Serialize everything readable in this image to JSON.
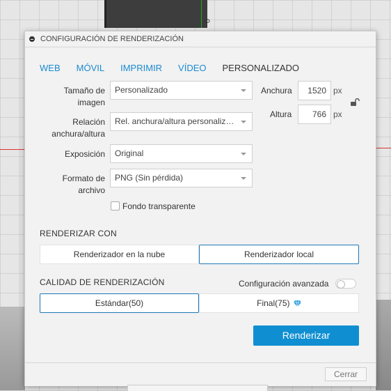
{
  "dialog": {
    "title": "CONFIGURACIÓN DE RENDERIZACIÓN",
    "tabs": [
      "WEB",
      "MÓVIL",
      "IMPRIMIR",
      "VÍDEO",
      "PERSONALIZADO"
    ],
    "active_tab": "PERSONALIZADO",
    "image_size": {
      "label": "Tamaño de imagen",
      "value": "Personalizado"
    },
    "aspect_ratio": {
      "label": "Relación anchura/altura",
      "value": "Rel. anchura/altura personaliza..."
    },
    "exposure": {
      "label": "Exposición",
      "value": "Original"
    },
    "file_format": {
      "label": "Formato de archivo",
      "value": "PNG (Sin pérdida)"
    },
    "width": {
      "label": "Anchura",
      "value": "1520",
      "unit": "px"
    },
    "height": {
      "label": "Altura",
      "value": "766",
      "unit": "px"
    },
    "transparent_bg": {
      "label": "Fondo transparente",
      "checked": false
    },
    "render_with": {
      "title": "RENDERIZAR CON",
      "options": [
        "Renderizador en la nube",
        "Renderizador local"
      ],
      "selected": "Renderizador local"
    },
    "quality": {
      "title": "CALIDAD DE RENDERIZACIÓN",
      "advanced_label": "Configuración avanzada",
      "advanced_enabled": false,
      "options": [
        "Estándar(50)",
        "Final(75)"
      ],
      "selected": "Estándar(50)"
    },
    "render_button": "Renderizar",
    "close_button": "Cerrar"
  },
  "viewport": {
    "axis_label": "0"
  },
  "colors": {
    "accent": "#0f8fd2",
    "link": "#1a8ad0",
    "diamond": "#2a9fd8"
  }
}
